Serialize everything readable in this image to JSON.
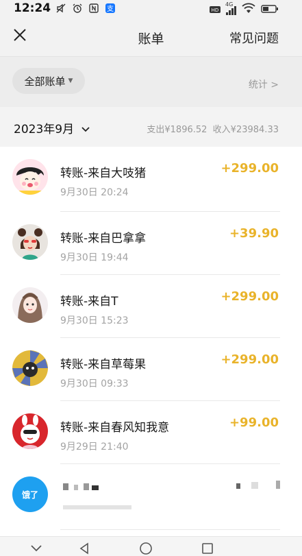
{
  "status_bar": {
    "time": "12:24",
    "network": "4G",
    "icons_left": [
      "mute-icon",
      "alarm-icon",
      "nfc-icon",
      "alipay-icon"
    ],
    "icons_right": [
      "hd-icon",
      "signal-icon",
      "wifi-icon",
      "battery-icon"
    ]
  },
  "header": {
    "title": "账单",
    "faq_label": "常见问题"
  },
  "filter": {
    "all_bills_label": "全部账单",
    "stats_label": "统计 >"
  },
  "month": {
    "label": "2023年9月",
    "summary": "支出¥1896.52  收入¥23984.33"
  },
  "transactions": [
    {
      "title": "转账-来自大吱猪",
      "time": "9月30日 20:24",
      "amount": "+299.00"
    },
    {
      "title": "转账-来自巴拿拿",
      "time": "9月30日 19:44",
      "amount": "+39.90"
    },
    {
      "title": "转账-来自T",
      "time": "9月30日 15:23",
      "amount": "+299.00"
    },
    {
      "title": "转账-来自草莓果",
      "time": "9月30日 09:33",
      "amount": "+299.00"
    },
    {
      "title": "转账-来自春风知我意",
      "time": "9月29日 21:40",
      "amount": "+99.00"
    }
  ],
  "partial_item": {
    "avatar_text": "饿了"
  },
  "colors": {
    "amount": "#e9b32a",
    "background": "#f2f2f2",
    "eleme_blue": "#1ea0f0"
  }
}
